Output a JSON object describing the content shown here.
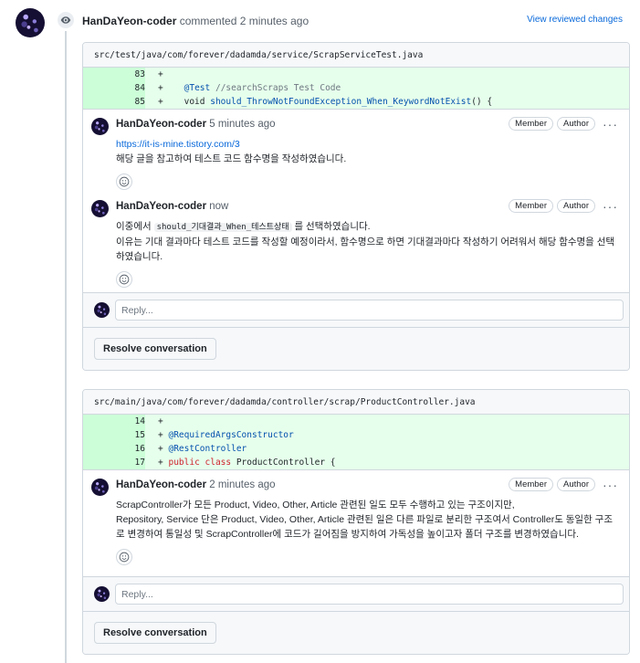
{
  "timeline": {
    "header_author": "HanDaYeon-coder",
    "header_action": "commented 2 minutes ago",
    "view_link": "View reviewed changes",
    "icons": {
      "event": "eye-icon"
    }
  },
  "threads": [
    {
      "file_path": "src/test/java/com/forever/dadamda/service/ScrapServiceTest.java",
      "lines": [
        {
          "num": "83",
          "sign": "+",
          "text": ""
        },
        {
          "num": "84",
          "sign": "+",
          "text": "    @Test //searchScraps Test Code"
        },
        {
          "num": "85",
          "sign": "+",
          "text": "    void should_ThrowNotFoundException_When_KeywordNotExist() {"
        }
      ],
      "comments": [
        {
          "author": "HanDaYeon-coder",
          "time": "5 minutes ago",
          "badge_member": "Member",
          "badge_author": "Author",
          "link": "https://it-is-mine.tistory.com/3",
          "body": "해당 글을 참고하여 테스트 코드 함수명을 작성하였습니다."
        },
        {
          "author": "HanDaYeon-coder",
          "time": "now",
          "badge_member": "Member",
          "badge_author": "Author",
          "line1_prefix": "이중에서 ",
          "line1_code": "should_기대결과_When_테스트상태",
          "line1_suffix": " 를 선택하였습니다.",
          "body": "이유는 기대 결과마다 테스트 코드를 작성할 예정이라서, 함수명으로 하면 기대결과마다 작성하기 어려워서 해당 함수명을 선택하였습니다."
        }
      ],
      "reply_placeholder": "Reply...",
      "resolve_label": "Resolve conversation"
    },
    {
      "file_path": "src/main/java/com/forever/dadamda/controller/scrap/ProductController.java",
      "lines": [
        {
          "num": "14",
          "sign": "+",
          "text": ""
        },
        {
          "num": "15",
          "sign": "+",
          "text": "@RequiredArgsConstructor"
        },
        {
          "num": "16",
          "sign": "+",
          "text": "@RestController"
        },
        {
          "num": "17",
          "sign": "+",
          "text": "public class ProductController {"
        }
      ],
      "comments": [
        {
          "author": "HanDaYeon-coder",
          "time": "2 minutes ago",
          "badge_member": "Member",
          "badge_author": "Author",
          "body_line1": "ScrapController가 모든 Product, Video, Other, Article 관련된 일도 모두 수행하고 있는 구조이지만,",
          "body_line2": "Repository, Service 단은 Product, Video, Other, Article 관련된 일은 다른 파일로 분리한 구조여서 Controller도 동일한 구조로 변경하여 통일성 및 ScrapController에 코드가 길어짐을 방지하여 가독성을 높이고자 폴더 구조를 변경하였습니다."
        }
      ],
      "reply_placeholder": "Reply...",
      "resolve_label": "Resolve conversation"
    }
  ],
  "colors": {
    "link": "#0969da",
    "diff_bg": "#e6ffec",
    "diff_num_bg": "#ccffd8",
    "border": "#d0d7de"
  }
}
